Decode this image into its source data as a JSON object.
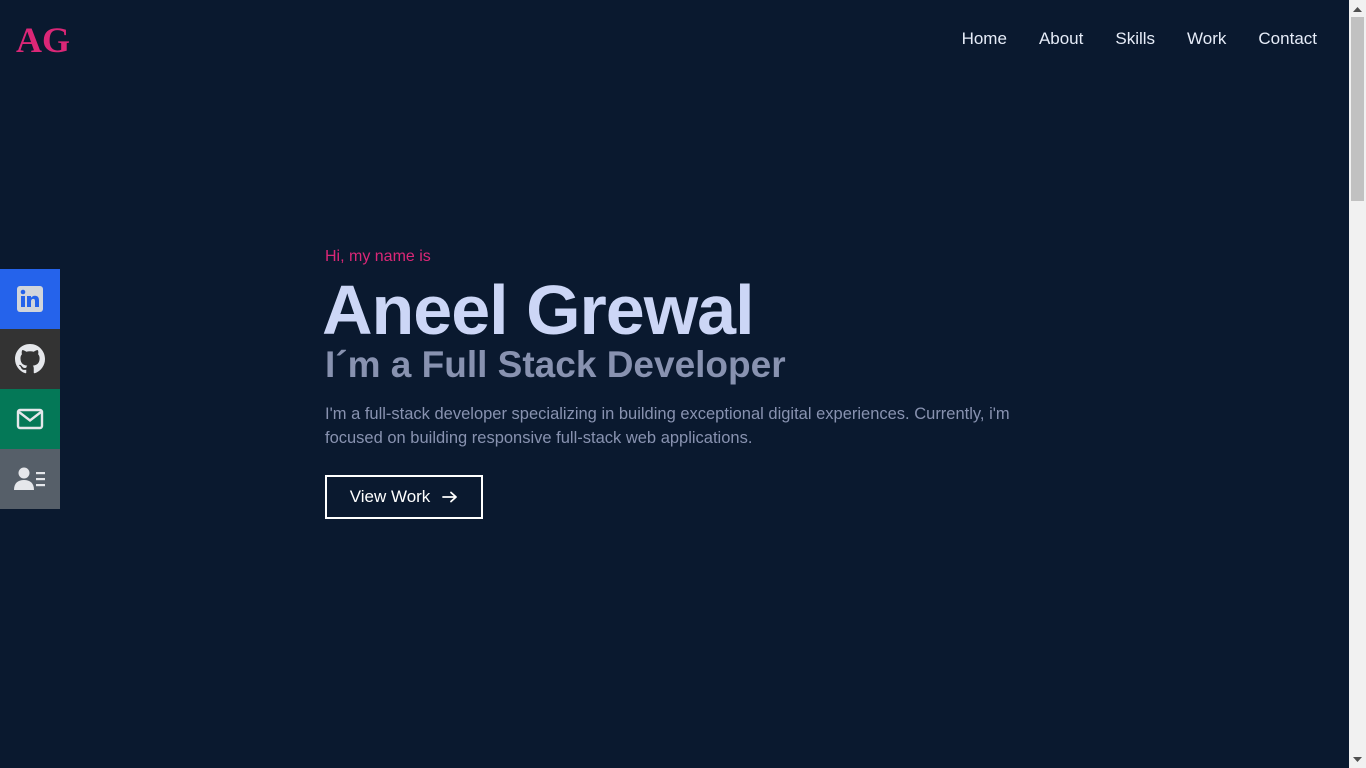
{
  "header": {
    "logo": "AG",
    "nav": [
      "Home",
      "About",
      "Skills",
      "Work",
      "Contact"
    ]
  },
  "social": {
    "items": [
      {
        "name": "linkedin-icon",
        "color": "#2563eb"
      },
      {
        "name": "github-icon",
        "color": "#333333"
      },
      {
        "name": "mail-icon",
        "color": "#047857"
      },
      {
        "name": "resume-icon",
        "color": "#565f69"
      }
    ]
  },
  "hero": {
    "intro": "Hi, my name is",
    "name": "Aneel Grewal",
    "role": "I´m a Full Stack Developer",
    "description": "I'm a full-stack developer specializing in building exceptional digital experiences. Currently, i'm focused on building responsive full-stack web applications.",
    "cta_label": "View Work",
    "cta_icon": "arrow-right-icon"
  },
  "colors": {
    "background": "#0a192f",
    "accent": "#db2777",
    "heading": "#ccd6f6",
    "muted": "#8892b0"
  }
}
